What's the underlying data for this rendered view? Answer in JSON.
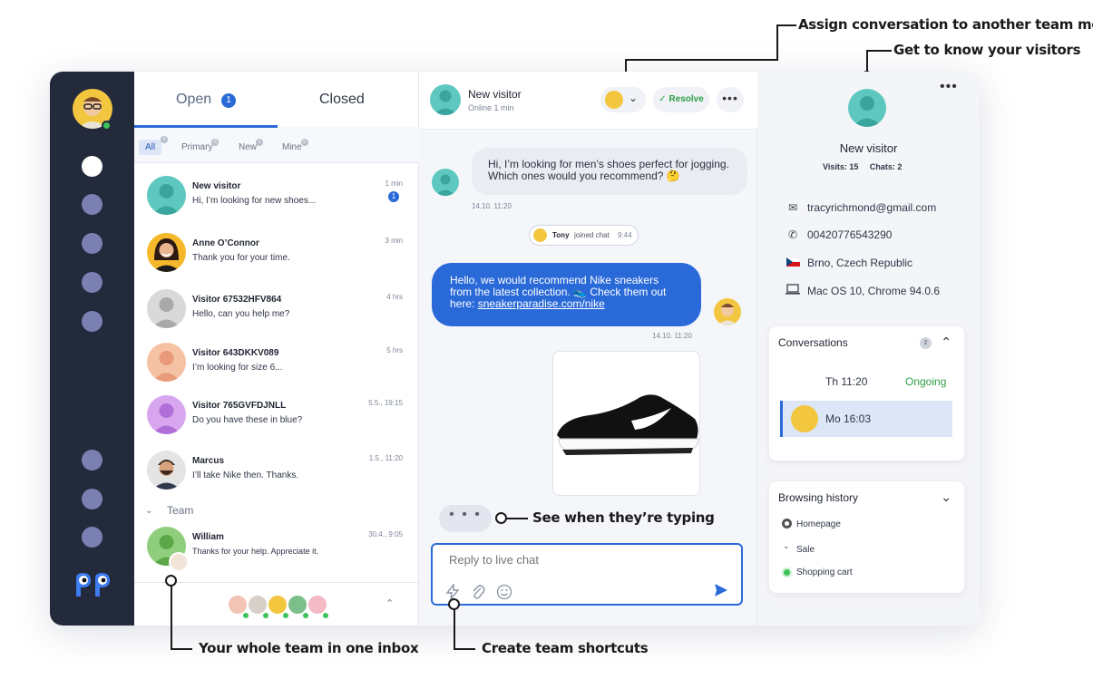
{
  "annotations": {
    "assign": "Assign conversation to another team member",
    "visitors": "Get to know your visitors",
    "typing": "See when they’re typing",
    "team": "Your whole team in one inbox",
    "shortcuts": "Create team shortcuts"
  },
  "list": {
    "tab_open": "Open",
    "tab_open_count": "1",
    "tab_closed": "Closed",
    "filters": [
      {
        "label": "All",
        "count": "6"
      },
      {
        "label": "Primary",
        "count": "6"
      },
      {
        "label": "New",
        "count": "1"
      },
      {
        "label": "Mine",
        "count": "0"
      }
    ],
    "conversations": [
      {
        "name": "New visitor",
        "message": "Hi, I’m looking for new shoes...",
        "time": "1 min",
        "badge": "1"
      },
      {
        "name": "Anne O’Connor",
        "message": "Thank you for your time.",
        "time": "3 min"
      },
      {
        "name": "Visitor 67532HFV864",
        "message": "Hello, can you help me?",
        "time": "4 hrs"
      },
      {
        "name": "Visitor 643DKKV089",
        "message": "I’m looking for size 6...",
        "time": "5 hrs"
      },
      {
        "name": "Visitor 765GVFDJNLL",
        "message": "Do you have these in blue?",
        "time": "5.5., 19:15"
      },
      {
        "name": "Marcus",
        "message": "I’ll take Nike then. Thanks.",
        "time": "1.5., 11:20"
      }
    ],
    "team_label": "Team",
    "team_conversation": {
      "name": "William",
      "message": "Thanks for your help. Appreciate it.",
      "time": "30.4., 9:05"
    }
  },
  "chat": {
    "visitor_name": "New visitor",
    "visitor_status": "Online 1 min",
    "resolve_label": "Resolve",
    "incoming_text": "Hi, I’m looking for men’s shoes perfect for jogging. Which ones would you recommend? 🤔",
    "incoming_time": "14.10. 11:20",
    "joined_name": "Tony",
    "joined_text": "joined chat",
    "joined_time": "9:44",
    "outgoing_text": "Hello, we would recommend Nike sneakers from the latest collection. 👟 Check them out here: ",
    "outgoing_link": "sneakerparadise.com/nike",
    "outgoing_time": "14.10. 11:20",
    "typing_indicator": "• • •",
    "composer_placeholder": "Reply to live chat"
  },
  "info": {
    "name": "New visitor",
    "visits_label": "Visits: 15",
    "chats_label": "Chats: 2",
    "email": "tracyrichmond@gmail.com",
    "phone": "00420776543290",
    "location": "Brno, Czech Republic",
    "device": "Mac OS 10, Chrome 94.0.6",
    "conversations_title": "Conversations",
    "conversations_count": "2",
    "conv_rows": [
      {
        "time": "Th 11:20",
        "status": "Ongoing"
      },
      {
        "time": "Mo 16:03",
        "status": ""
      }
    ],
    "browsing_title": "Browsing history",
    "browsing": [
      "Homepage",
      "Sale",
      "Shopping cart"
    ]
  },
  "colors": {
    "accent": "#2a6ad8",
    "rail": "#232a3c",
    "online": "#3ec25a",
    "ongoing": "#2f9e44"
  },
  "icons": [
    "email-icon",
    "phone-icon",
    "flag-cz-icon",
    "laptop-icon",
    "lightning-icon",
    "paperclip-icon",
    "emoji-icon",
    "send-icon",
    "more-icon",
    "check-icon",
    "chevron-down-icon",
    "chevron-up-icon"
  ]
}
